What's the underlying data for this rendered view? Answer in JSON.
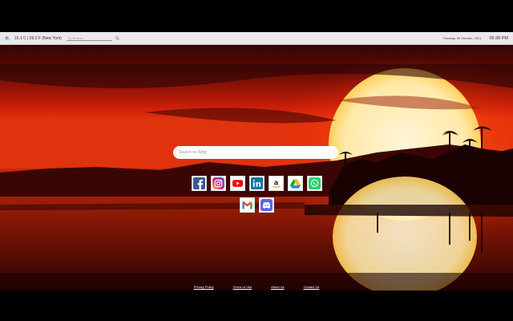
{
  "topbar": {
    "weather": "15.1 C | 59.2 F (New York)",
    "search_placeholder": "Try Browse...",
    "date": "Tuesday, 26 October, 2021",
    "time": "05:38 PM"
  },
  "search": {
    "placeholder": "Search on Bing!"
  },
  "apps_row1": [
    {
      "name": "Facebook",
      "icon": "facebook-icon"
    },
    {
      "name": "Instagram",
      "icon": "instagram-icon"
    },
    {
      "name": "YouTube",
      "icon": "youtube-icon"
    },
    {
      "name": "LinkedIn",
      "icon": "linkedin-icon"
    },
    {
      "name": "Amazon",
      "icon": "amazon-icon"
    },
    {
      "name": "Google Drive",
      "icon": "google-drive-icon"
    },
    {
      "name": "WhatsApp",
      "icon": "whatsapp-icon"
    }
  ],
  "apps_row2": [
    {
      "name": "Gmail",
      "icon": "gmail-icon"
    },
    {
      "name": "Discord",
      "icon": "discord-icon"
    }
  ],
  "footer": {
    "privacy": "Privacy Policy",
    "terms": "Terms of Use",
    "about": "About Us",
    "contact": "Contact Us"
  },
  "colors": {
    "facebook": "#3b5998",
    "youtube": "#ff0000",
    "linkedin": "#0e76a8",
    "whatsapp": "#25d366",
    "discord": "#5865f2"
  }
}
